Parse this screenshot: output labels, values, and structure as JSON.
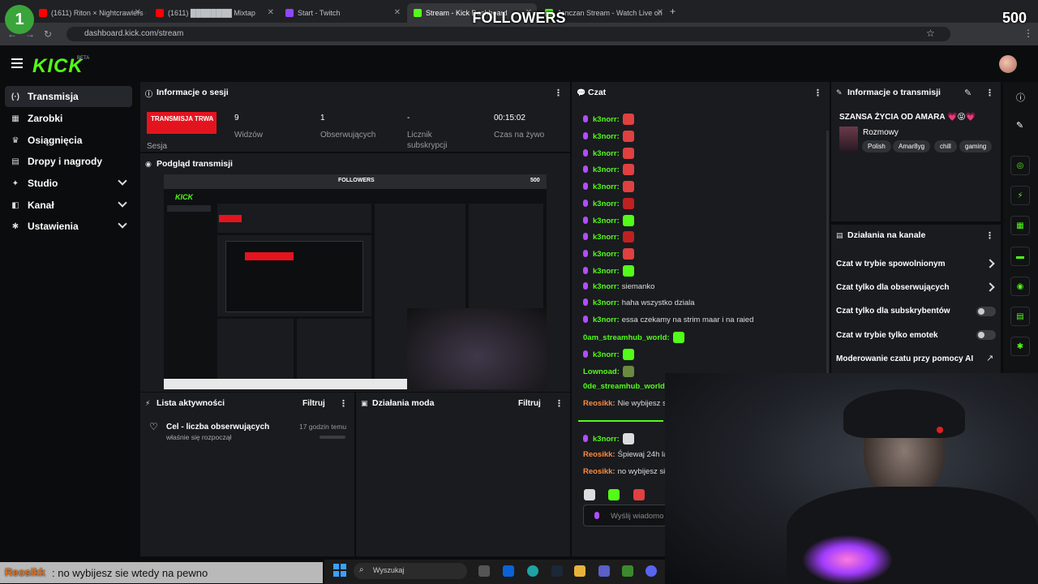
{
  "browser": {
    "tabs": [
      {
        "label": "(1611) Riton × Nightcrawlers -",
        "color": "#ff0000"
      },
      {
        "label": "(1611) ████████ Mixtap",
        "color": "#ff0000"
      },
      {
        "label": "Start - Twitch",
        "color": "#9146ff"
      },
      {
        "label": "Stream - Kick Dashboard",
        "color": "#53fc18"
      },
      {
        "label": "Jenczan Stream - Watch Live on",
        "color": "#53fc18"
      }
    ],
    "url": "dashboard.kick.com/stream"
  },
  "overlay": {
    "followers_label": "FOLLOWERS",
    "followers_count": "500",
    "badge": "1"
  },
  "header": {
    "logo": "KICK",
    "logo_beta": "BETA"
  },
  "sidebar": {
    "items": [
      {
        "label": "Transmisja",
        "icon": "broadcast-icon",
        "glyph": "(·)"
      },
      {
        "label": "Zarobki",
        "icon": "earnings-icon",
        "glyph": "▦"
      },
      {
        "label": "Osiągnięcia",
        "icon": "trophy-icon",
        "glyph": "♛"
      },
      {
        "label": "Dropy i nagrody",
        "icon": "gift-icon",
        "glyph": "▤"
      },
      {
        "label": "Studio",
        "icon": "studio-icon",
        "glyph": "✦"
      },
      {
        "label": "Kanał",
        "icon": "channel-icon",
        "glyph": "◧"
      },
      {
        "label": "Ustawienia",
        "icon": "gear-icon",
        "glyph": "✱"
      }
    ]
  },
  "session": {
    "title": "Informacje o sesji",
    "live_badge": "TRANSMISJA TRWA",
    "session_label": "Sesja",
    "stats": [
      {
        "value": "9",
        "label": "Widzów"
      },
      {
        "value": "1",
        "label": "Obserwujących"
      },
      {
        "value": "-",
        "label": "Licznik subskrypcji"
      },
      {
        "value": "00:15:02",
        "label": "Czas na żywo"
      }
    ]
  },
  "preview": {
    "title": "Podgląd transmisji"
  },
  "activity": {
    "title": "Lista aktywności",
    "filter": "Filtruj",
    "item_title": "Cel - liczba obserwujących",
    "item_sub": "właśnie się rozpoczął",
    "item_time": "17 godzin temu"
  },
  "mod": {
    "title": "Działania moda",
    "filter": "Filtruj"
  },
  "chat": {
    "title": "Czat",
    "messages": [
      {
        "user": "k3norr:",
        "text": "",
        "color": "#53fc18",
        "mic": true,
        "emote": "#e04040"
      },
      {
        "user": "k3norr:",
        "text": "",
        "color": "#53fc18",
        "mic": true,
        "emote": "#e04040"
      },
      {
        "user": "k3norr:",
        "text": "",
        "color": "#53fc18",
        "mic": true,
        "emote": "#e04040"
      },
      {
        "user": "k3norr:",
        "text": "",
        "color": "#53fc18",
        "mic": true,
        "emote": "#e04040"
      },
      {
        "user": "k3norr:",
        "text": "",
        "color": "#53fc18",
        "mic": true,
        "emote": "#e04040"
      },
      {
        "user": "k3norr:",
        "text": "",
        "color": "#53fc18",
        "mic": true,
        "emote": "#c02020"
      },
      {
        "user": "k3norr:",
        "text": "",
        "color": "#53fc18",
        "mic": true,
        "emote": "#53fc18"
      },
      {
        "user": "k3norr:",
        "text": "",
        "color": "#53fc18",
        "mic": true,
        "emote": "#c02020"
      },
      {
        "user": "k3norr:",
        "text": "",
        "color": "#53fc18",
        "mic": true,
        "emote": "#e04040"
      },
      {
        "user": "k3norr:",
        "text": "",
        "color": "#53fc18",
        "mic": true,
        "emote": "#53fc18"
      },
      {
        "user": "k3norr:",
        "text": "siemanko",
        "color": "#53fc18",
        "mic": true,
        "emote": ""
      },
      {
        "user": "k3norr:",
        "text": "haha wszystko dziala",
        "color": "#53fc18",
        "mic": true,
        "emote": ""
      },
      {
        "user": "k3norr:",
        "text": "essa czekamy na strim maar i na raied",
        "color": "#53fc18",
        "mic": true,
        "emote": ""
      },
      {
        "user": "0am_streamhub_world:",
        "text": "",
        "color": "#53fc18",
        "mic": false,
        "emote": "#53fc18"
      },
      {
        "user": "k3norr:",
        "text": "",
        "color": "#53fc18",
        "mic": true,
        "emote": "#53fc18"
      },
      {
        "user": "Lownoad:",
        "text": "",
        "color": "#53fc18",
        "mic": false,
        "emote": "#6a8a40"
      },
      {
        "user": "0de_streamhub_world:",
        "text": "",
        "color": "#53fc18",
        "mic": false,
        "emote": ""
      },
      {
        "user": "Reosikk:",
        "text": "Nie wybijesz sie",
        "color": "#ff8a3d",
        "mic": false,
        "emote": ""
      },
      {
        "user": "k3norr:",
        "text": "",
        "color": "#53fc18",
        "mic": true,
        "emote": "#dddddd"
      },
      {
        "user": "Reosikk:",
        "text": "Śpiewaj 24h las",
        "color": "#ff8a3d",
        "mic": false,
        "emote": ""
      },
      {
        "user": "Reosikk:",
        "text": "no wybijesz sie",
        "color": "#ff8a3d",
        "mic": false,
        "emote": ""
      }
    ],
    "input_placeholder": "Wyślij wiadomo"
  },
  "stream_info": {
    "title": "Informacje o transmisji",
    "stream_title": "SZANSA ŻYCIA OD AMARA 💗😝💗",
    "category": "Rozmowy",
    "tags": [
      "Polish",
      "Amar8yg",
      "chill",
      "gaming"
    ]
  },
  "channel_actions": {
    "title": "Działania na kanale",
    "items": [
      {
        "label": "Czat w trybie spowolnionym",
        "type": "chevron"
      },
      {
        "label": "Czat tylko dla obserwujących",
        "type": "chevron"
      },
      {
        "label": "Czat tylko dla subskrybentów",
        "type": "toggle"
      },
      {
        "label": "Czat w trybie tylko emotek",
        "type": "toggle"
      },
      {
        "label": "Moderowanie czatu przy pomocy AI",
        "type": "external"
      }
    ]
  },
  "taskbar": {
    "search_placeholder": "Wyszukaj"
  },
  "bottom_chat": {
    "user": "Reosikk",
    "message": ": no wybijesz sie wtedy na pewno"
  }
}
